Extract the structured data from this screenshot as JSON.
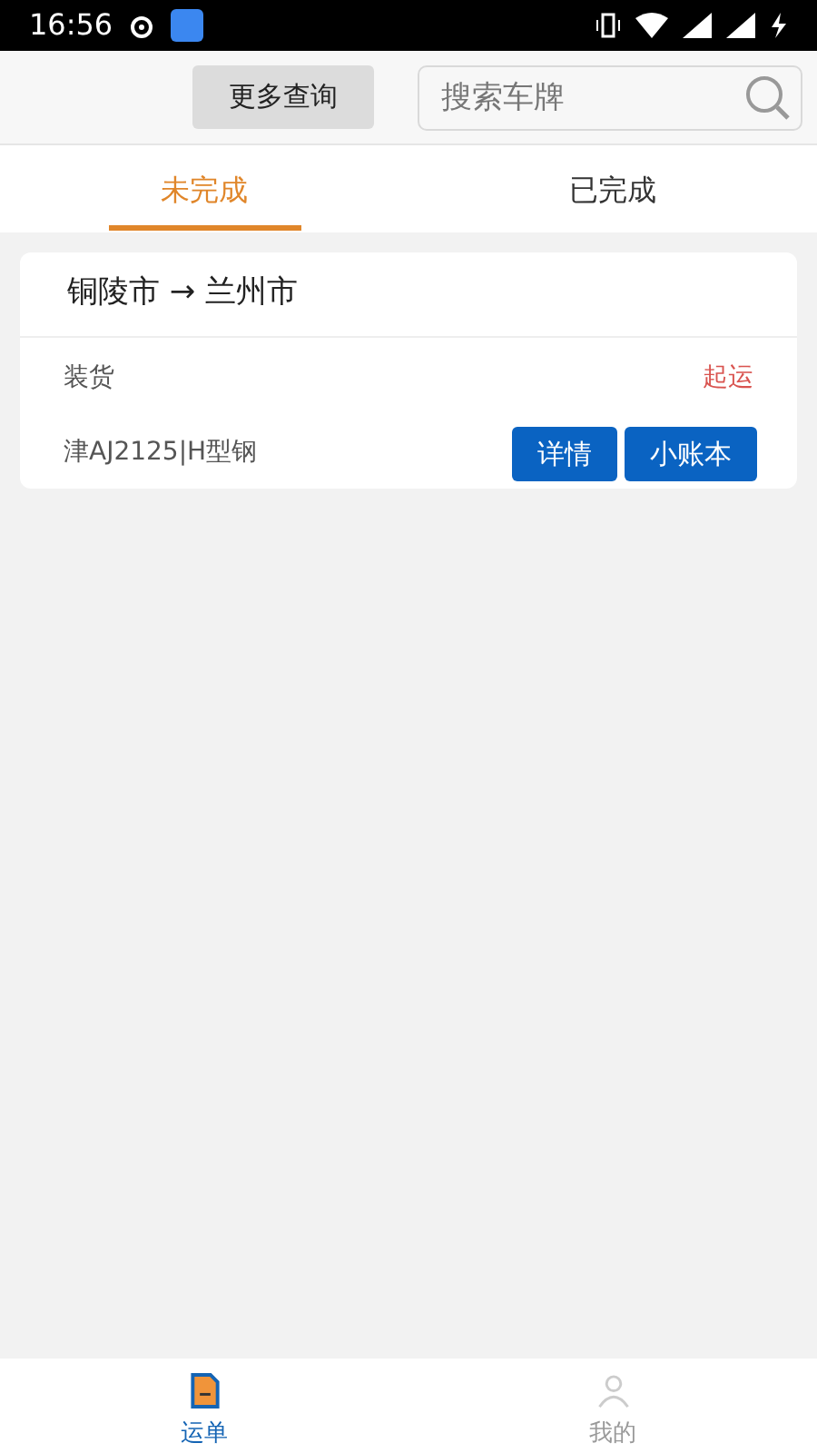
{
  "status_bar": {
    "time": "16:56"
  },
  "header": {
    "more_button": "更多查询",
    "search": {
      "placeholder": "搜索车牌"
    }
  },
  "tabs": [
    {
      "label": "未完成",
      "selected": true
    },
    {
      "label": "已完成",
      "selected": false
    }
  ],
  "orders": [
    {
      "route": "铜陵市 → 兰州市",
      "stage": "装货",
      "status": "起运",
      "cargo": "津AJ2125|H型钢",
      "buttons": [
        "详情",
        "小账本"
      ]
    }
  ],
  "bottom_nav": [
    {
      "label": "运单",
      "kind": "waybill",
      "selected": true
    },
    {
      "label": "我的",
      "kind": "profile",
      "selected": false
    }
  ]
}
